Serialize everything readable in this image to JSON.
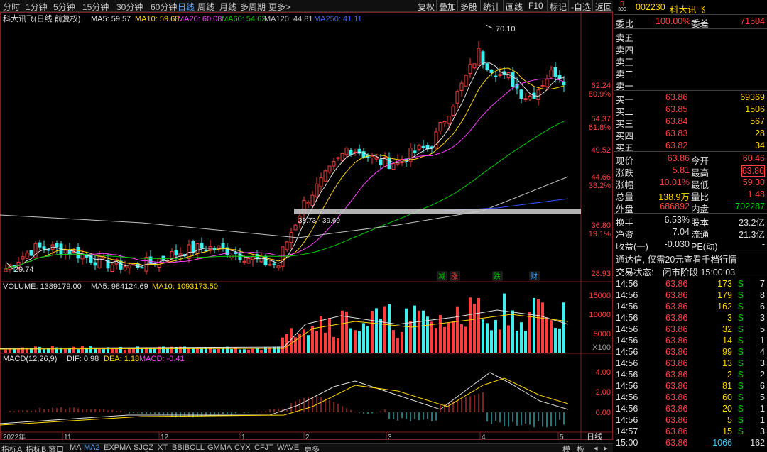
{
  "periods": [
    "分时",
    "1分钟",
    "5分钟",
    "15分钟",
    "30分钟",
    "60分钟",
    "日线",
    "周线",
    "月线",
    "多周期",
    "更多>"
  ],
  "active_period": "日线",
  "toolbar": [
    "复权",
    "叠加",
    "多股",
    "统计",
    "画线",
    "F10",
    "标记",
    "-自选",
    "返回"
  ],
  "chart": {
    "title": "科大讯飞(日线 前复权)",
    "ma_labels": [
      {
        "text": "MA5: 59.57",
        "color": "#e0e0e0"
      },
      {
        "text": "MA10: 59.68",
        "color": "#ffd700"
      },
      {
        "text": "MA20: 60.08",
        "color": "#ff40ff"
      },
      {
        "text": "MA60: 54.62",
        "color": "#00d000"
      },
      {
        "text": "MA120: 44.81",
        "color": "#c0c0c0"
      },
      {
        "text": "MA250: 41.11",
        "color": "#4060ff"
      }
    ],
    "price_axis": [
      {
        "text": "62.24",
        "color": "#ff4040"
      },
      {
        "text": "80.9%",
        "color": "#ff4040"
      },
      {
        "text": "54.37",
        "color": "#ff4040"
      },
      {
        "text": "61.8%",
        "color": "#ff4040"
      },
      {
        "text": "49.52",
        "color": "#ff4040"
      },
      {
        "text": "44.66",
        "color": "#ff4040"
      },
      {
        "text": "38.2%",
        "color": "#ff4040"
      },
      {
        "text": "36.80",
        "color": "#ff4040"
      },
      {
        "text": "19.1%",
        "color": "#ff4040"
      },
      {
        "text": "28.93",
        "color": "#ff4040"
      }
    ],
    "high_label": "70.10",
    "low_label": "29.74",
    "gap_label": "38.73 - 39.69",
    "markers": [
      {
        "text": "减",
        "color": "#00c000"
      },
      {
        "text": "涨",
        "color": "#ff4040"
      },
      {
        "text": "跌",
        "color": "#00c000"
      },
      {
        "text": "财",
        "color": "#40a0ff"
      }
    ]
  },
  "volume": {
    "label": "VOLUME: 1389179.00",
    "ma5": "MA5: 984124.69",
    "ma10": "MA10: 1093173.50",
    "axis": [
      "15000",
      "10000",
      "5000",
      "X100"
    ]
  },
  "macd": {
    "label": "MACD(12,26,9)",
    "dif": "DIF: 0.98",
    "dea": "DEA: 1.18",
    "macd": "MACD: -0.41",
    "axis": [
      "4.00",
      "2.00",
      "0.00"
    ]
  },
  "date_axis": [
    "2022年",
    "11",
    "12",
    "1",
    "2",
    "3",
    "4",
    "5"
  ],
  "date_axis_right": "日线",
  "tabs": [
    "指标A",
    "指标B",
    "窗口",
    "MA",
    "MA2",
    "EXPMA",
    "SJQZ",
    "XT",
    "BBIBOLL",
    "GMMA",
    "CYX",
    "CFJT",
    "WAVE",
    "更多"
  ],
  "active_tab": "MA2",
  "bottom_right_tabs": [
    "模",
    "板"
  ],
  "stock": {
    "badge_r": "R",
    "badge_300": "300",
    "code": "002230",
    "name": "科大讯飞",
    "weibi_label": "委比",
    "weibi": "100.00%",
    "weicha_label": "委差",
    "weicha": "71504",
    "sell": [
      {
        "label": "卖五",
        "price": "",
        "vol": ""
      },
      {
        "label": "卖四",
        "price": "",
        "vol": ""
      },
      {
        "label": "卖三",
        "price": "",
        "vol": ""
      },
      {
        "label": "卖二",
        "price": "",
        "vol": ""
      },
      {
        "label": "卖一",
        "price": "",
        "vol": ""
      }
    ],
    "buy": [
      {
        "label": "买一",
        "price": "63.86",
        "vol": "69369"
      },
      {
        "label": "买二",
        "price": "63.85",
        "vol": "1506"
      },
      {
        "label": "买三",
        "price": "63.84",
        "vol": "567"
      },
      {
        "label": "买四",
        "price": "63.83",
        "vol": "28"
      },
      {
        "label": "买五",
        "price": "63.82",
        "vol": "34"
      }
    ],
    "quote": [
      {
        "l1": "现价",
        "v1": "63.86",
        "c1": "#ff4040",
        "l2": "今开",
        "v2": "60.46",
        "c2": "#ff4040"
      },
      {
        "l1": "涨跌",
        "v1": "5.81",
        "c1": "#ff4040",
        "l2": "最高",
        "v2": "63.86",
        "c2": "#ff4040"
      },
      {
        "l1": "涨幅",
        "v1": "10.01%",
        "c1": "#ff4040",
        "l2": "最低",
        "v2": "59.30",
        "c2": "#ff4040"
      },
      {
        "l1": "总量",
        "v1": "138.9万",
        "c1": "#ffd700",
        "l2": "量比",
        "v2": "1.48",
        "c2": "#ff4040"
      },
      {
        "l1": "外盘",
        "v1": "686892",
        "c1": "#ff4040",
        "l2": "内盘",
        "v2": "702287",
        "c2": "#00d000"
      }
    ],
    "fin": [
      {
        "l1": "换手",
        "v1": "6.53%",
        "l2": "股本",
        "v2": "23.2亿"
      },
      {
        "l1": "净资",
        "v1": "7.04",
        "l2": "流通",
        "v2": "21.3亿"
      },
      {
        "l1": "收益(一)",
        "v1": "-0.030",
        "l2": "PE(动)",
        "v2": "-"
      }
    ],
    "promo": "通达信, 仅需20元查看千档行情",
    "status_label": "交易状态:",
    "status": "闭市阶段 15:00:03",
    "ticks": [
      {
        "t": "14:56",
        "p": "63.86",
        "v": "173",
        "s": "S",
        "n": "7"
      },
      {
        "t": "14:56",
        "p": "63.86",
        "v": "179",
        "s": "S",
        "n": "8"
      },
      {
        "t": "14:56",
        "p": "63.86",
        "v": "162",
        "s": "S",
        "n": "6"
      },
      {
        "t": "14:56",
        "p": "63.86",
        "v": "3",
        "s": "S",
        "n": "3"
      },
      {
        "t": "14:56",
        "p": "63.86",
        "v": "32",
        "s": "S",
        "n": "5"
      },
      {
        "t": "14:56",
        "p": "63.86",
        "v": "14",
        "s": "S",
        "n": "1"
      },
      {
        "t": "14:56",
        "p": "63.86",
        "v": "99",
        "s": "S",
        "n": "4"
      },
      {
        "t": "14:56",
        "p": "63.86",
        "v": "13",
        "s": "S",
        "n": "3"
      },
      {
        "t": "14:56",
        "p": "63.86",
        "v": "2",
        "s": "S",
        "n": "2"
      },
      {
        "t": "14:56",
        "p": "63.86",
        "v": "81",
        "s": "S",
        "n": "6"
      },
      {
        "t": "14:56",
        "p": "63.86",
        "v": "60",
        "s": "S",
        "n": "5"
      },
      {
        "t": "14:56",
        "p": "63.86",
        "v": "20",
        "s": "S",
        "n": "1"
      },
      {
        "t": "14:56",
        "p": "63.86",
        "v": "5",
        "s": "S",
        "n": "1"
      },
      {
        "t": "14:57",
        "p": "63.86",
        "v": "15",
        "s": "S",
        "n": "3"
      },
      {
        "t": "15:00",
        "p": "63.86",
        "v": "1066",
        "s": "",
        "n": "162"
      }
    ]
  }
}
